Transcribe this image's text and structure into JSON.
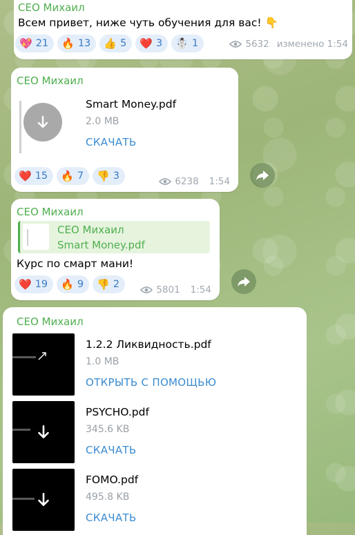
{
  "msg1": {
    "sender": "СЕО Михаил",
    "text": "Всем привет, ниже чуть обучения для вас! 👇",
    "reactions": [
      {
        "emoji": "💖",
        "count": "21"
      },
      {
        "emoji": "🔥",
        "count": "13"
      },
      {
        "emoji": "👍",
        "count": "5"
      },
      {
        "emoji": "❤️",
        "count": "3"
      },
      {
        "emoji": "☃️",
        "count": "1"
      }
    ],
    "views": "5632",
    "time": "изменено 1:54"
  },
  "msg2": {
    "sender": "СЕО Михаил",
    "file_name": "Smart Money.pdf",
    "file_size": "2.0 MB",
    "action": "СКАЧАТЬ",
    "reactions": [
      {
        "emoji": "❤️",
        "count": "15"
      },
      {
        "emoji": "🔥",
        "count": "7"
      },
      {
        "emoji": "👎",
        "count": "3"
      }
    ],
    "views": "6238",
    "time": "1:54"
  },
  "msg3": {
    "sender": "СЕО Михаил",
    "reply_sender": "СЕО Михаил",
    "reply_text": "Smart Money.pdf",
    "text": "Курс по смарт мани!",
    "reactions": [
      {
        "emoji": "❤️",
        "count": "19"
      },
      {
        "emoji": "🔥",
        "count": "9"
      },
      {
        "emoji": "👎",
        "count": "2"
      }
    ],
    "views": "5801",
    "time": "1:54"
  },
  "msg4": {
    "sender": "СЕО Михаил",
    "files": [
      {
        "name": "1.2.2 Ликвидность.pdf",
        "size": "1.0 MB",
        "action": "ОТКРЫТЬ С ПОМОЩЬЮ"
      },
      {
        "name": "PSYCHO.pdf",
        "size": "345.6 KB",
        "action": "СКАЧАТЬ"
      },
      {
        "name": "FOMO.pdf",
        "size": "495.8 KB",
        "action": "СКАЧАТЬ"
      }
    ]
  },
  "colors": {
    "sender": "#4fae4e",
    "link": "#3a8bd0",
    "reaction_bg": "#e4eefa"
  },
  "icons": {
    "views": "eye-icon",
    "share": "share-arrow-icon",
    "download": "download-arrow-icon"
  }
}
